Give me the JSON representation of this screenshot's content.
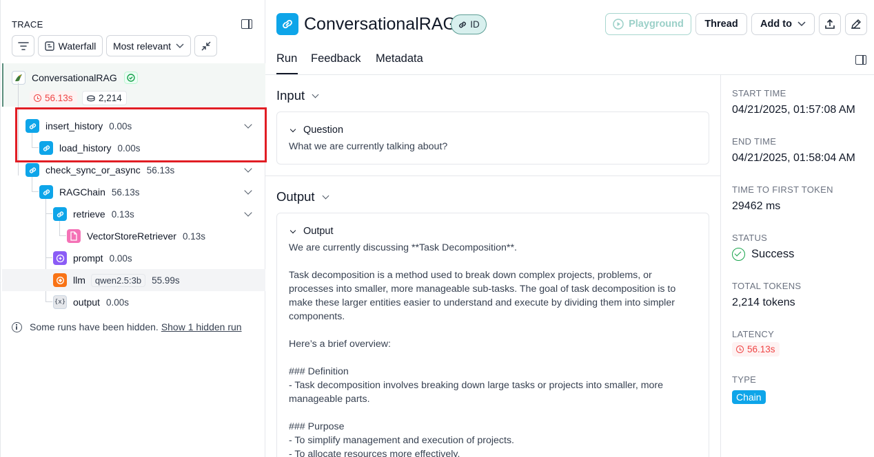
{
  "trace": {
    "title": "TRACE",
    "toolbar": {
      "waterfall_label": "Waterfall",
      "sort_label": "Most relevant"
    },
    "root": {
      "name": "ConversationalRAG",
      "latency": "56.13s",
      "tokens": "2,214"
    },
    "runs": [
      {
        "name": "insert_history",
        "duration": "0.00s",
        "type": "chain"
      },
      {
        "name": "load_history",
        "duration": "0.00s",
        "type": "chain"
      },
      {
        "name": "check_sync_or_async",
        "duration": "56.13s",
        "type": "chain"
      },
      {
        "name": "RAGChain",
        "duration": "56.13s",
        "type": "chain"
      },
      {
        "name": "retrieve",
        "duration": "0.13s",
        "type": "chain"
      },
      {
        "name": "VectorStoreRetriever",
        "duration": "0.13s",
        "type": "retriever"
      },
      {
        "name": "prompt",
        "duration": "0.00s",
        "type": "prompt"
      },
      {
        "name": "llm",
        "duration": "55.99s",
        "type": "llm",
        "model": "qwen2.5:3b"
      },
      {
        "name": "output",
        "duration": "0.00s",
        "type": "parser",
        "icon_text": "{x}"
      }
    ],
    "hidden_note": "Some runs have been hidden.",
    "hidden_link": "Show 1 hidden run"
  },
  "header": {
    "title": "ConversationalRAG",
    "id_label": "ID",
    "playground_label": "Playground",
    "thread_label": "Thread",
    "add_to_label": "Add to"
  },
  "tabs": [
    {
      "label": "Run",
      "active": true
    },
    {
      "label": "Feedback",
      "active": false
    },
    {
      "label": "Metadata",
      "active": false
    }
  ],
  "input": {
    "section_title": "Input",
    "field_label": "Question",
    "field_value": "What we are currently talking about?"
  },
  "output": {
    "section_title": "Output",
    "field_label": "Output",
    "lines": [
      "We are currently discussing **Task Decomposition**.",
      "",
      "Task decomposition is a method used to break down complex projects, problems, or",
      "processes into smaller, more manageable sub-tasks. The goal of task decomposition is to",
      "make these larger entities easier to understand and execute by dividing them into simpler",
      "components.",
      "",
      "Here’s a brief overview:",
      "",
      "### Definition",
      "- Task decomposition involves breaking down large tasks or projects into smaller, more",
      "manageable parts.",
      "",
      "### Purpose",
      "- To simplify management and execution of projects.",
      "- To allocate resources more effectively."
    ]
  },
  "meta": {
    "start_time_label": "START TIME",
    "start_time": "04/21/2025, 01:57:08 AM",
    "end_time_label": "END TIME",
    "end_time": "04/21/2025, 01:58:04 AM",
    "ttft_label": "TIME TO FIRST TOKEN",
    "ttft": "29462 ms",
    "status_label": "STATUS",
    "status": "Success",
    "total_tokens_label": "TOTAL TOKENS",
    "total_tokens": "2,214 tokens",
    "latency_label": "LATENCY",
    "latency": "56.13s",
    "type_label": "TYPE",
    "type": "Chain"
  },
  "colors": {
    "chain": "#0ea5e9",
    "retriever": "#f472b6",
    "prompt": "#8b5cf6",
    "llm": "#f97316",
    "error_red": "#ef4444",
    "success_green": "#16a34a",
    "highlight_box": "#e11d24"
  }
}
